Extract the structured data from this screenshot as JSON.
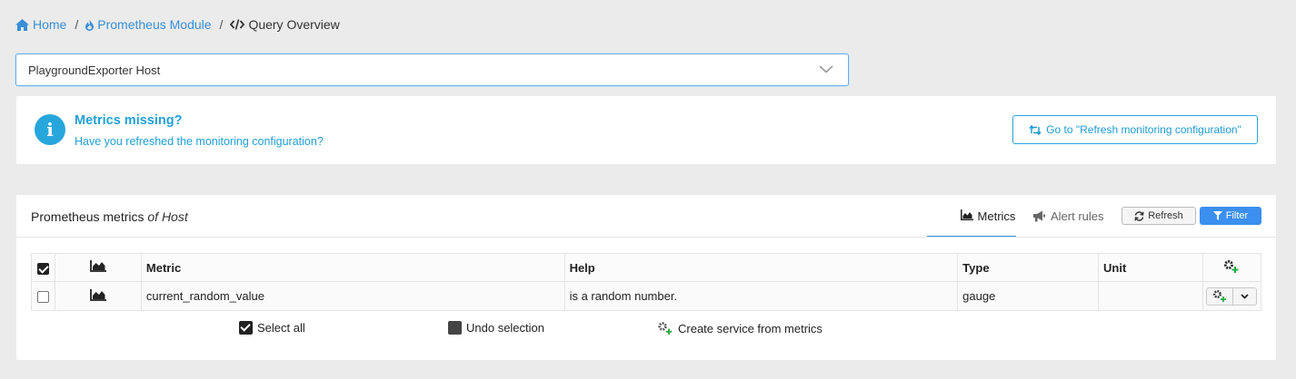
{
  "breadcrumb": {
    "home": "Home",
    "module": "Prometheus Module",
    "current": "Query Overview",
    "separator": "/"
  },
  "host_select": {
    "value": "PlaygroundExporter Host"
  },
  "alert": {
    "title": "Metrics missing?",
    "subtitle": "Have you refreshed the monitoring configuration?",
    "button_label": "Go to \"Refresh monitoring configuration\""
  },
  "panel": {
    "title": "Prometheus metrics",
    "title_suffix": "of Host",
    "tabs": [
      {
        "label": "Metrics",
        "icon": "area-chart-icon",
        "active": true
      },
      {
        "label": "Alert rules",
        "icon": "bullhorn-icon",
        "active": false
      }
    ],
    "refresh_label": "Refresh",
    "filter_label": "Filter"
  },
  "table": {
    "columns": [
      "Metric",
      "Help",
      "Type",
      "Unit"
    ],
    "rows": [
      {
        "metric": "current_random_value",
        "help": "is a random number.",
        "type": "gauge",
        "unit": "",
        "checked": false
      }
    ],
    "header_checked": true
  },
  "bottom_actions": {
    "select_all": "Select all",
    "undo_selection": "Undo selection",
    "create_service": "Create service from metrics"
  },
  "colors": {
    "link": "#3a8fd9",
    "info": "#22a0d6",
    "primary_button": "#3a8fef",
    "page_bg": "#ebebeb"
  }
}
